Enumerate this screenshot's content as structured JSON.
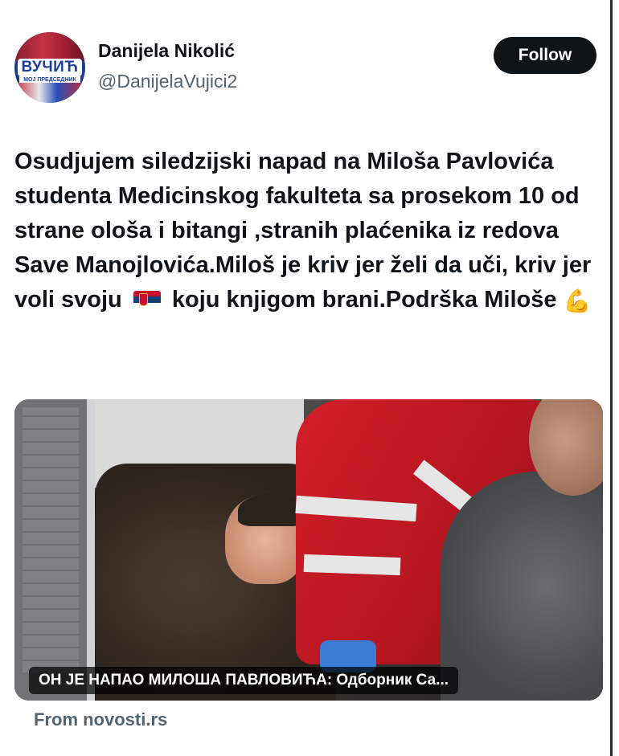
{
  "author": {
    "name": "Danijela Nikolić",
    "handle": "@DanijelaVujici2",
    "avatar_text": "ВУЧИЋ",
    "avatar_subtext": "МОЈ ПРЕДСЕДНИК"
  },
  "follow_label": "Follow",
  "tweet": {
    "text_part1": "Osudjujem siledzijski napad na Miloša Pavlovića studenta Medicinskog fakulteta sa prosekom 10 od strane ološa i bitangi ,stranih plaćenika iz redova Save Manojlovića.Miloš je kriv jer želi da uči, kriv jer voli svoju",
    "flag_emoji_name": "serbia-flag-icon",
    "text_part2": "koju knjigom brani.Podrška Miloše",
    "flex_emoji": "💪"
  },
  "media": {
    "caption": "ОН ЈЕ НАПАО МИЛОША ПАВЛОВИЋА: Одборник Са..."
  },
  "source": "From novosti.rs",
  "colors": {
    "follow_bg": "#0f1419",
    "handle": "#536471"
  }
}
